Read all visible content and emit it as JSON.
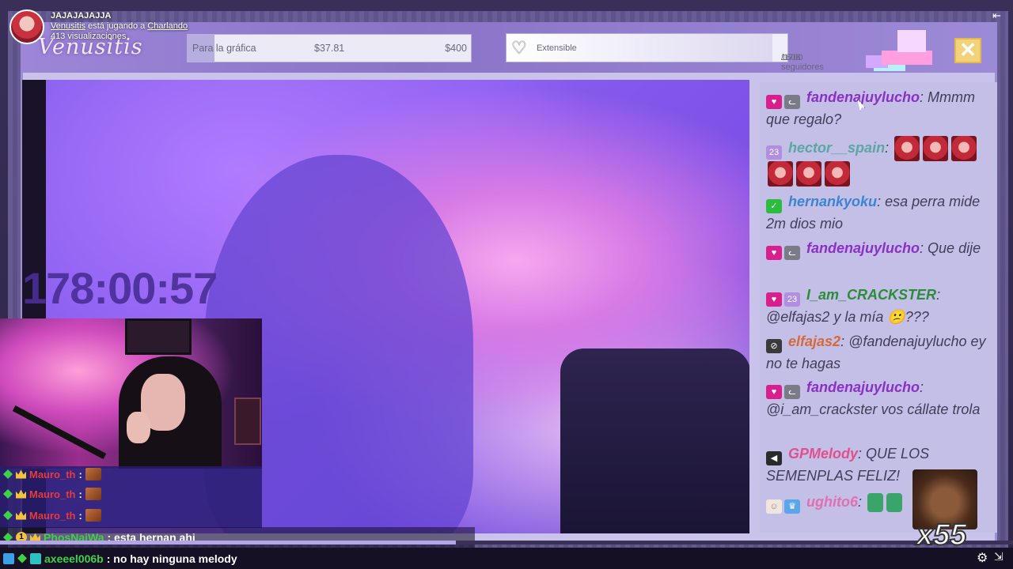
{
  "stream": {
    "title": "JAJAJAJAJJA",
    "streamer": "Venusitis",
    "playing_text": "está jugando a",
    "category": "Charlando",
    "views": "413 visualizaciones",
    "logo": "Venusitis"
  },
  "goal": {
    "label": "Para la gráfica",
    "current": "$37.81",
    "target": "$400",
    "progress_fraction": 0.095
  },
  "followers": {
    "label": "Extensible",
    "current": "1608",
    "total": "/1700 seguidores",
    "progress_fraction": 0.946
  },
  "timer": "178:00:57",
  "close_label": "✕",
  "chat": [
    {
      "badges": [
        "heart-icon",
        "cat-icon"
      ],
      "name": "fandenajuylucho",
      "name_color": "#8b2fc9",
      "text": "Mmmm que regalo?"
    },
    {
      "badges": [
        "sub-badge-icon"
      ],
      "name": "hector__spain",
      "name_color": "#5aa7a3",
      "text": "",
      "emotes": 6
    },
    {
      "badges": [
        "green-badge-icon"
      ],
      "name": "hernankyoku",
      "name_color": "#3a84d4",
      "text": "esa perra mide 2m dios mio"
    },
    {
      "badges": [
        "heart-icon",
        "cat-icon"
      ],
      "name": "fandenajuylucho",
      "name_color": "#8b2fc9",
      "text": "Que dije"
    },
    {
      "badges": [
        "heart-icon",
        "sub-badge-icon"
      ],
      "name": "I_am_CRACKSTER",
      "name_color": "#2c8c3a",
      "text": "@elfajas2 y la mía 😕???"
    },
    {
      "badges": [
        "slash-icon"
      ],
      "name": "elfajas2",
      "name_color": "#d46a3a",
      "text": "@fandenajuylucho ey no te hagas"
    },
    {
      "badges": [
        "heart-icon",
        "cat-icon"
      ],
      "name": "fandenajuylucho",
      "name_color": "#8b2fc9",
      "text": "@i_am_crackster vos cállate trola"
    },
    {
      "badges": [
        "volume-icon"
      ],
      "name": "GPMelody",
      "name_color": "#e0508c",
      "text": "QUE LOS SEMENPLAS FELIZ!"
    },
    {
      "badges": [
        "face-icon",
        "crown-icon"
      ],
      "name": "ughito6",
      "name_color": "#e070b0",
      "text": ""
    }
  ],
  "big_emote_count": "x55",
  "minichat": [
    {
      "name": "Mauro_th",
      "sep": ":"
    },
    {
      "name": "Mauro_th",
      "sep": ":"
    },
    {
      "name": "Mauro_th",
      "sep": ":"
    }
  ],
  "bottom_chat": [
    {
      "name": "PhosNaiWa",
      "name_color": "#3fd04a",
      "text": ": esta hernan ahi",
      "badge_num": "1"
    },
    {
      "name": "axeeel006b",
      "name_color": "#3fd04a",
      "text": ": no hay ninguna melody"
    }
  ],
  "player": {
    "progress_fraction": 0.45,
    "gear": "⚙",
    "expand": "⇲",
    "collapse": "⇤"
  },
  "colors": {
    "accent": "#9c86d8",
    "chat_bg": "#c4bfe6",
    "goal_fill": "#b7aee0"
  }
}
